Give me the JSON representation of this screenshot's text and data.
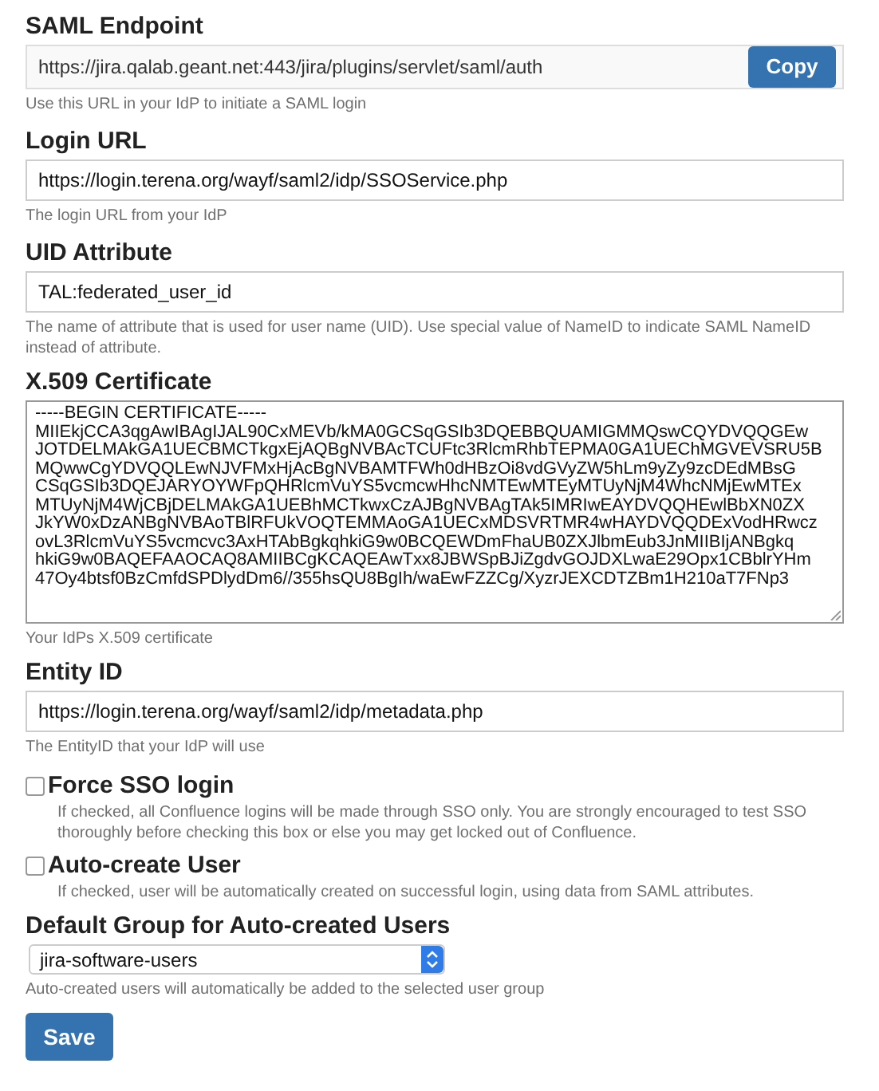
{
  "saml_endpoint": {
    "label": "SAML Endpoint",
    "value": "https://jira.qalab.geant.net:443/jira/plugins/servlet/saml/auth",
    "button": "Copy",
    "help": "Use this URL in your IdP to initiate a SAML login"
  },
  "login_url": {
    "label": "Login URL",
    "value": "https://login.terena.org/wayf/saml2/idp/SSOService.php",
    "help": "The login URL from your IdP"
  },
  "uid_attribute": {
    "label": "UID Attribute",
    "value": "TAL:federated_user_id",
    "help": "The name of attribute that is used for user name (UID). Use special value of NameID to indicate SAML NameID instead of attribute."
  },
  "certificate": {
    "label": "X.509 Certificate",
    "lines": [
      "-----BEGIN CERTIFICATE-----",
      "MIIEkjCCA3qgAwIBAgIJAL90CxMEVb/kMA0GCSqGSIb3DQEBBQUAMIGMMQswCQYDVQQGEw",
      "JOTDELMAkGA1UECBMCTkgxEjAQBgNVBAcTCUFtc3RlcmRhbTEPMA0GA1UEChMGVEVSRU5B",
      "MQwwCgYDVQQLEwNJVFMxHjAcBgNVBAMTFWh0dHBzOi8vdGVyZW5hLm9yZy9zcDEdMBsG",
      "CSqGSIb3DQEJARYOYWFpQHRlcmVuYS5vcmcwHhcNMTEwMTEyMTUyNjM4WhcNMjEwMTEx",
      "MTUyNjM4WjCBjDELMAkGA1UEBhMCTkwxCzAJBgNVBAgTAk5IMRIwEAYDVQQHEwlBbXN0ZX",
      "JkYW0xDzANBgNVBAoTBlRFUkVOQTEMMAoGA1UECxMDSVRTMR4wHAYDVQQDExVodHRwcz",
      "ovL3RlcmVuYS5vcmcvc3AxHTAbBgkqhkiG9w0BCQEWDmFhaUB0ZXJlbmEub3JnMIIBIjANBgkq",
      "hkiG9w0BAQEFAAOCAQ8AMIIBCgKCAQEAwTxx8JBWSpBJiZgdvGOJDXLwaE29Opx1CBblrYHm",
      "47Oy4btsf0BzCmfdSPDlydDm6//355hsQU8BgIh/waEwFZZCg/XyzrJEXCDTZBm1H210aT7FNp3"
    ],
    "help": "Your IdPs X.509 certificate"
  },
  "entity_id": {
    "label": "Entity ID",
    "value": "https://login.terena.org/wayf/saml2/idp/metadata.php",
    "help": "The EntityID that your IdP will use"
  },
  "options": [
    {
      "label": "Force SSO login",
      "checked": false,
      "help": "If checked, all Confluence logins will be made through SSO only. You are strongly encouraged to test SSO thoroughly before checking this box or else you may get locked out of Confluence."
    },
    {
      "label": "Auto-create User",
      "checked": false,
      "help": "If checked, user will be automatically created on successful login, using data from SAML attributes."
    }
  ],
  "default_group": {
    "label": "Default Group for Auto-created Users",
    "value": "jira-software-users",
    "help": "Auto-created users will automatically be added to the selected user group"
  },
  "save_button": "Save"
}
